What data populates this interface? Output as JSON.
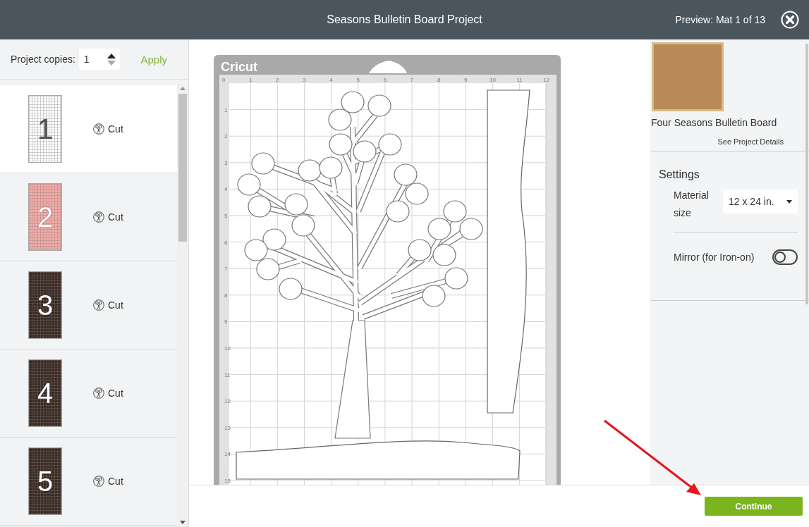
{
  "header": {
    "title": "Seasons Bulletin Board Project",
    "preview": "Preview: Mat 1 of 13"
  },
  "copies": {
    "label": "Project copies:",
    "value": "1",
    "apply": "Apply"
  },
  "mats": [
    {
      "number": "1",
      "color": "#ffffff",
      "action": "Cut",
      "selected": true
    },
    {
      "number": "2",
      "color": "#f4aaa6",
      "action": "Cut",
      "selected": false
    },
    {
      "number": "3",
      "color": "#3a2a22",
      "action": "Cut",
      "selected": false
    },
    {
      "number": "4",
      "color": "#3a2a22",
      "action": "Cut",
      "selected": false
    },
    {
      "number": "5",
      "color": "#3a2a22",
      "action": "Cut",
      "selected": false
    }
  ],
  "canvas": {
    "brand": "Cricut",
    "x_ruler": [
      "0",
      "1",
      "2",
      "3",
      "4",
      "5",
      "6",
      "7",
      "8",
      "9",
      "10",
      "11",
      "12"
    ],
    "y_ruler": [
      "1",
      "2",
      "3",
      "4",
      "5",
      "6",
      "7",
      "8",
      "9",
      "10",
      "11",
      "12",
      "13",
      "14",
      "15"
    ]
  },
  "project": {
    "name": "Four Seasons Bulletin Board",
    "details_link": "See Project Details"
  },
  "settings": {
    "heading": "Settings",
    "material_label": "Material size",
    "material_value": "12 x 24 in.",
    "mirror_label": "Mirror (for Iron-on)",
    "mirror_on": false
  },
  "continue": "Continue"
}
